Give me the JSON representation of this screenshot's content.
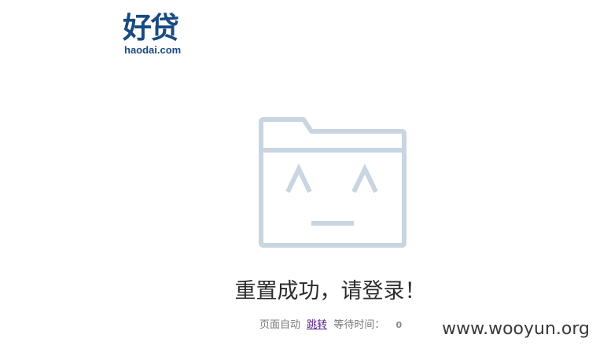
{
  "logo": {
    "text_cn": "好贷",
    "text_en": "haodai.com",
    "color": "#1a4a80"
  },
  "illustration": {
    "icon": "folder-face-icon",
    "face_text": "^ ^",
    "color": "#c9d5e0"
  },
  "message": "重置成功，请登录！",
  "redirect": {
    "prefix": "页面自动",
    "link_label": "跳转",
    "wait_label": "等待时间：",
    "countdown": "0"
  },
  "watermark": "www.wooyun.org"
}
